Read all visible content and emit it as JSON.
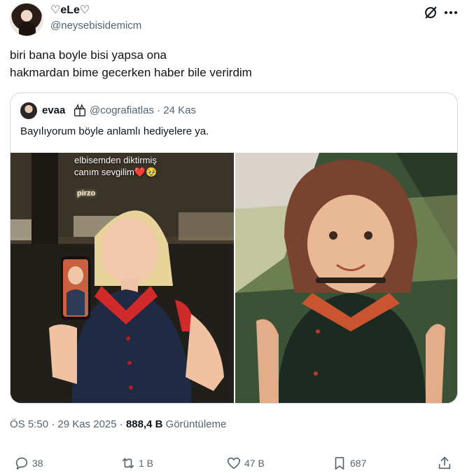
{
  "author": {
    "display_name": "♡eLe♡",
    "handle": "@neysebisidemicm"
  },
  "tweet": {
    "text": "biri bana boyle bisi yapsa ona\nhakmardan bime gecerken haber bile verirdim"
  },
  "quote": {
    "name": "evaa",
    "emoji_icon": "gift-icon",
    "handle_time": "@cografiatlas · 24 Kas",
    "text": "Bayılıyorum böyle anlamlı hediyelere ya.",
    "left_photo_caption_line1": "elbisemden diktirmiş",
    "left_photo_caption_line2": "canım sevgilim❤️🥹",
    "left_photo_sign": "pirzo"
  },
  "meta": {
    "time_date": "ÖS 5:50 · 29 Kas 2025 · ",
    "views_count": "888,4 B",
    "views_label": " Görüntüleme"
  },
  "actions": {
    "replies": "38",
    "reposts": "1 B",
    "likes": "47 B",
    "bookmarks": "687"
  },
  "colors": {
    "text": "#0f1419",
    "secondary": "#536471",
    "border": "#cfd9de",
    "dress_red": "#d02a2a",
    "dress_navy": "#1f2a44"
  }
}
